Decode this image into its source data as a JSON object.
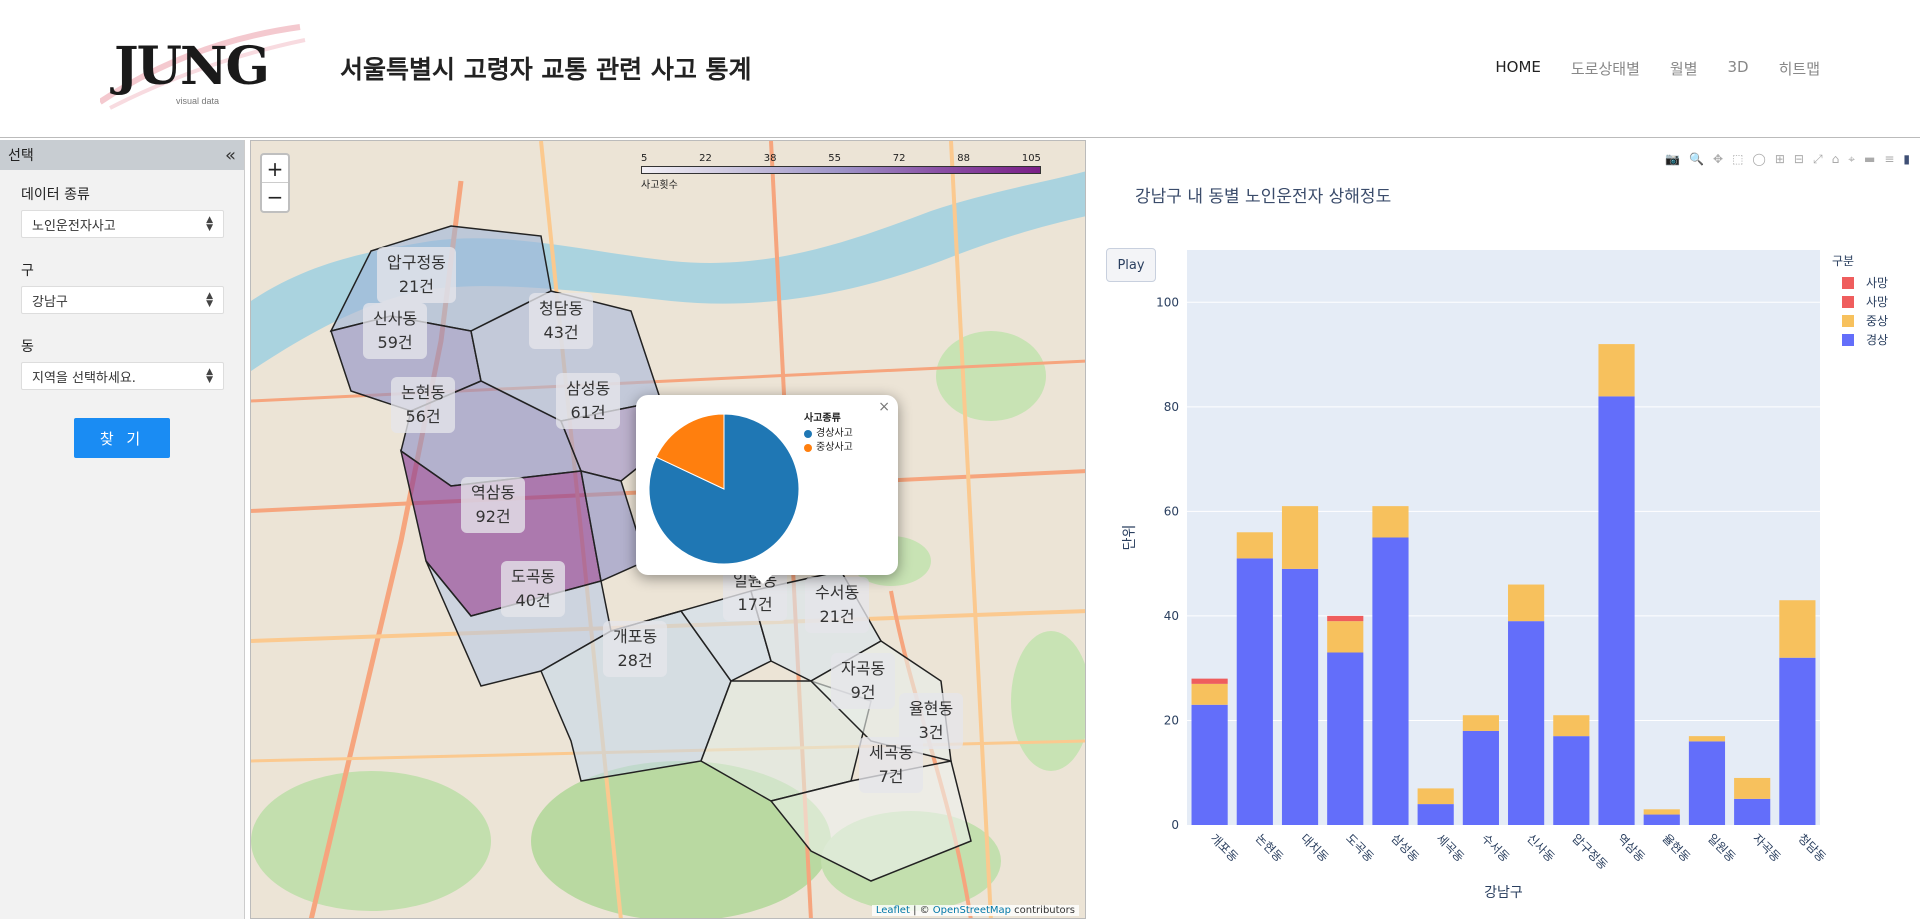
{
  "header": {
    "logo_text": "JUNG",
    "logo_sub": "visual data",
    "title": "서울특별시 고령자 교통 관련 사고 통계",
    "nav": [
      "HOME",
      "도로상태별",
      "월별",
      "3D",
      "히트맵"
    ]
  },
  "sidebar": {
    "title": "선택",
    "collapse_icon": "«",
    "fields": [
      {
        "label": "데이터 종류",
        "value": "노인운전자사고"
      },
      {
        "label": "구",
        "value": "강남구"
      },
      {
        "label": "동",
        "value": "지역을 선택하세요."
      }
    ],
    "find_button": "찾 기"
  },
  "map": {
    "zoom_in": "+",
    "zoom_out": "−",
    "scale_ticks": [
      "5",
      "22",
      "38",
      "55",
      "72",
      "88",
      "105"
    ],
    "scale_caption": "사고횟수",
    "attribution_leaflet": "Leaflet",
    "attribution_rest": " | © ",
    "attribution_osm": "OpenStreetMap",
    "attribution_tail": " contributors",
    "districts": [
      {
        "name": "압구정동",
        "count": "21건"
      },
      {
        "name": "신사동",
        "count": "59건"
      },
      {
        "name": "청담동",
        "count": "43건"
      },
      {
        "name": "논현동",
        "count": "56건"
      },
      {
        "name": "삼성동",
        "count": "61건"
      },
      {
        "name": "역삼동",
        "count": "92건"
      },
      {
        "name": "도곡동",
        "count": "40건"
      },
      {
        "name": "일원동",
        "count": "17건"
      },
      {
        "name": "수서동",
        "count": "21건"
      },
      {
        "name": "개포동",
        "count": "28건"
      },
      {
        "name": "자곡동",
        "count": "9건"
      },
      {
        "name": "율현동",
        "count": "3건"
      },
      {
        "name": "세곡동",
        "count": "7건"
      }
    ],
    "popup": {
      "legend_title": "사고종류",
      "items": [
        {
          "label": "경상사고",
          "value": 82,
          "color": "#1f77b4"
        },
        {
          "label": "중상사고",
          "value": 18,
          "color": "#ff7f0e"
        }
      ],
      "close": "×"
    }
  },
  "chart_data": {
    "type": "bar",
    "stacked": true,
    "title": "강남구 내 동별 노인운전자 상해정도",
    "xlabel": "강남구",
    "ylabel": "단위",
    "ylim": [
      0,
      110
    ],
    "yticks": [
      0,
      20,
      40,
      60,
      80,
      100
    ],
    "play_label": "Play",
    "legend_title": "구분",
    "categories": [
      "개포동",
      "논현동",
      "대치동",
      "도곡동",
      "삼성동",
      "세곡동",
      "수서동",
      "신사동",
      "압구정동",
      "역삼동",
      "율현동",
      "일원동",
      "자곡동",
      "청담동"
    ],
    "series": [
      {
        "name": "경상",
        "color": "#636efa",
        "values": [
          23,
          51,
          49,
          33,
          55,
          4,
          18,
          39,
          17,
          82,
          2,
          16,
          5,
          32
        ]
      },
      {
        "name": "중상",
        "color": "#f7c15d",
        "values": [
          4,
          5,
          12,
          6,
          6,
          3,
          3,
          7,
          4,
          10,
          1,
          1,
          4,
          11
        ]
      },
      {
        "name": "사망",
        "color": "#ef5d5d",
        "values": [
          1,
          0,
          0,
          1,
          0,
          0,
          0,
          0,
          0,
          0,
          0,
          0,
          0,
          0
        ]
      }
    ],
    "legend_entries": [
      {
        "name": "사망",
        "color": "#ef5d5d"
      },
      {
        "name": "사망",
        "color": "#ef5d5d"
      },
      {
        "name": "중상",
        "color": "#f7c15d"
      },
      {
        "name": "경상",
        "color": "#636efa"
      }
    ]
  }
}
